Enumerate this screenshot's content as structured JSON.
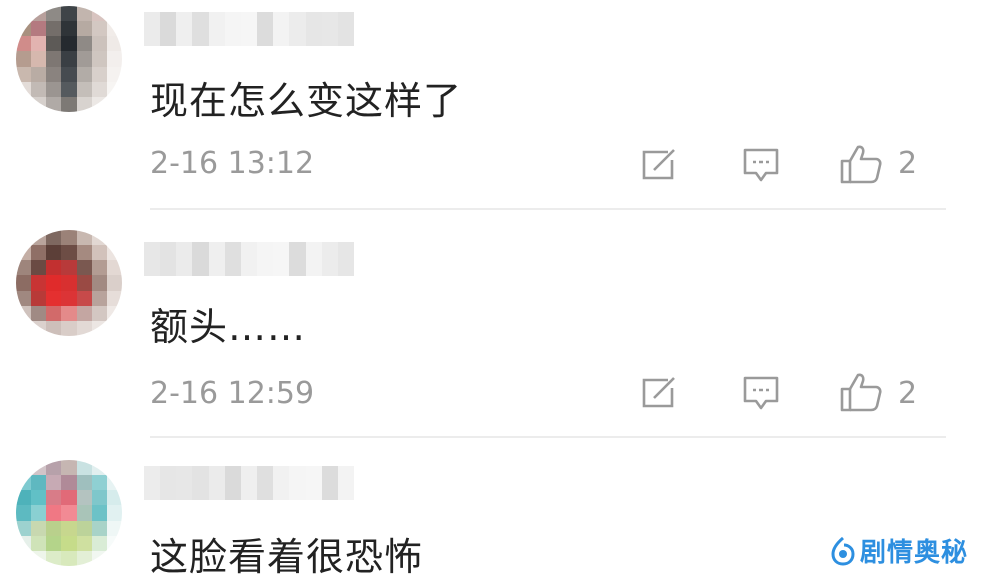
{
  "comments": [
    {
      "text": "现在怎么变这样了",
      "time": "2-16 13:12",
      "likes": "2",
      "icons": {
        "share": "share-icon",
        "reply": "reply-icon",
        "like": "thumbs-up-icon"
      }
    },
    {
      "text": "额头……",
      "time": "2-16 12:59",
      "likes": "2",
      "icons": {
        "share": "share-icon",
        "reply": "reply-icon",
        "like": "thumbs-up-icon"
      }
    },
    {
      "text": "这脸看着很恐怖"
    }
  ],
  "watermark": {
    "text": "剧情奥秘"
  },
  "colors": {
    "icon": "#9a9a9a",
    "text": "#222222",
    "meta": "#9a9a9a",
    "watermark": "#2d8fe0"
  }
}
